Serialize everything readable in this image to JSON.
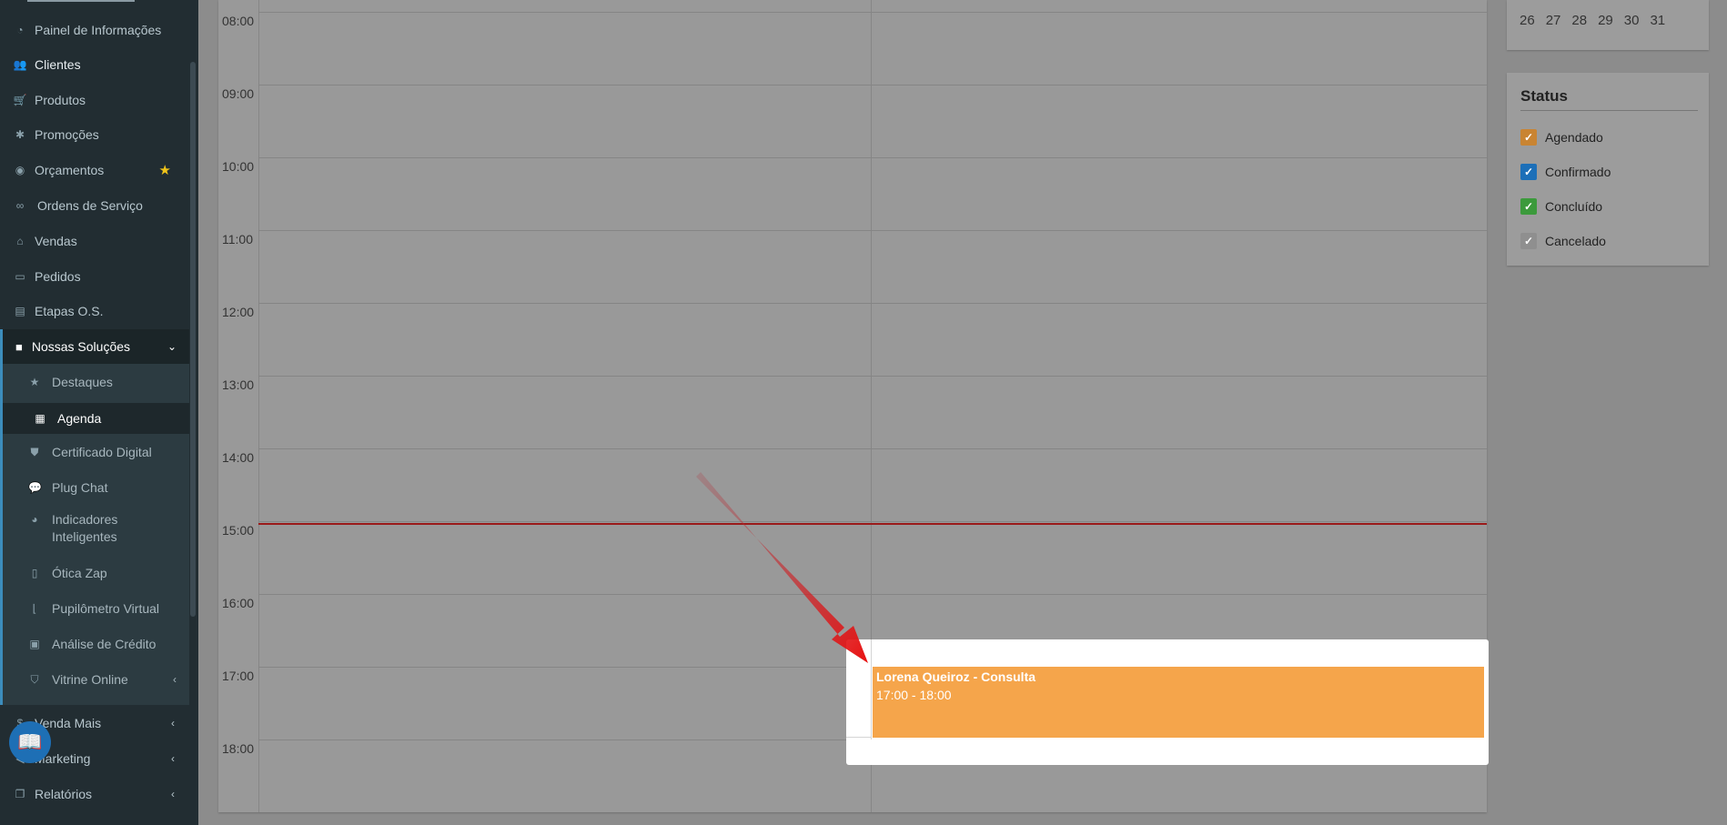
{
  "sidebar": {
    "items": [
      {
        "label": "Painel de Informações",
        "icon": "dashboard-icon"
      },
      {
        "label": "Clientes",
        "icon": "users-icon"
      },
      {
        "label": "Produtos",
        "icon": "cart-icon"
      },
      {
        "label": "Promoções",
        "icon": "asterisk-icon"
      },
      {
        "label": "Orçamentos",
        "icon": "budget-icon"
      },
      {
        "label": "Ordens de Serviço",
        "icon": "glasses-icon"
      },
      {
        "label": "Vendas",
        "icon": "basket-icon"
      },
      {
        "label": "Pedidos",
        "icon": "inbox-icon"
      },
      {
        "label": "Etapas O.S.",
        "icon": "steps-icon"
      }
    ],
    "solutions": {
      "label": "Nossas Soluções",
      "icon": "briefcase-icon",
      "items": [
        {
          "label": "Destaques",
          "icon": "star-icon"
        },
        {
          "label": "Agenda",
          "icon": "calendar-icon"
        },
        {
          "label": "Certificado Digital",
          "icon": "shield-icon"
        },
        {
          "label": "Plug Chat",
          "icon": "chat-icon"
        },
        {
          "label": "Indicadores Inteligentes",
          "icon": "pie-chart-icon"
        },
        {
          "label": "Ótica Zap",
          "icon": "mobile-icon"
        },
        {
          "label": "Pupilômetro Virtual",
          "icon": "ruler-icon"
        },
        {
          "label": "Análise de Crédito",
          "icon": "id-card-icon"
        },
        {
          "label": "Vitrine Online",
          "icon": "bag-icon"
        }
      ]
    },
    "bottom_items": [
      {
        "label": "Venda Mais",
        "icon": "dollar-icon"
      },
      {
        "label": "Marketing",
        "icon": "megaphone-icon"
      },
      {
        "label": "Relatórios",
        "icon": "copy-icon"
      }
    ]
  },
  "calendar": {
    "hours": [
      "08:00",
      "09:00",
      "10:00",
      "11:00",
      "12:00",
      "13:00",
      "14:00",
      "15:00",
      "16:00",
      "17:00",
      "18:00"
    ],
    "event": {
      "title": "Lorena Queiroz - Consulta",
      "time": "17:00 - 18:00",
      "color": "#f5a54b"
    }
  },
  "mini_calendar": {
    "days": [
      "26",
      "27",
      "28",
      "29",
      "30",
      "31"
    ]
  },
  "status": {
    "heading": "Status",
    "items": [
      {
        "label": "Agendado",
        "color": "#c98432"
      },
      {
        "label": "Confirmado",
        "color": "#1c6fb8"
      },
      {
        "label": "Concluído",
        "color": "#3c9a3c"
      },
      {
        "label": "Cancelado",
        "color": "#8f8f8f"
      }
    ]
  }
}
